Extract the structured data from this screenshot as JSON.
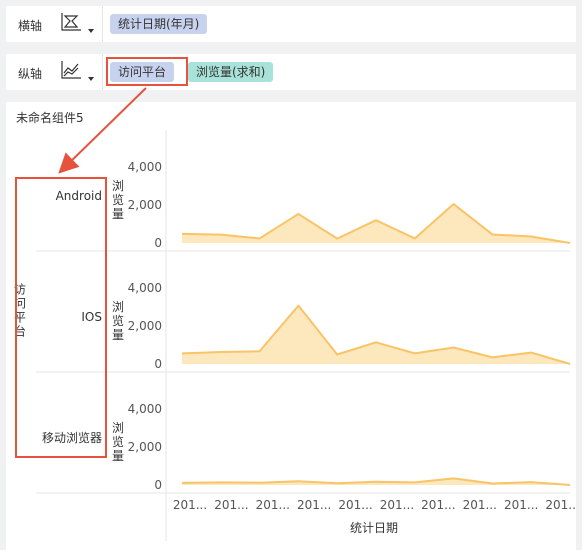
{
  "x_shelf": {
    "label": "横轴",
    "icon": "area-chart-icon",
    "fields": [
      "统计日期(年月)"
    ]
  },
  "y_shelf": {
    "label": "纵轴",
    "icon": "line-chart-icon",
    "fields": [
      "访问平台",
      "浏览量(求和)"
    ]
  },
  "widget": {
    "title": "未命名组件5"
  },
  "colors": {
    "area_fill": "#fde3b0",
    "area_line": "#f8c467",
    "dim_pill": "#c7d3ee",
    "measure_pill": "#a8e2d9",
    "highlight": "#e5533d"
  },
  "chart_data": {
    "type": "area",
    "row_dimension": "访问平台",
    "x_title": "统计日期",
    "y_title": "浏览量",
    "ylim": [
      0,
      4000
    ],
    "y_ticks": [
      "4,000",
      "2,000",
      "0"
    ],
    "y_tick_values": [
      4000,
      2000,
      0
    ],
    "x_ticks": [
      "201...",
      "201...",
      "201...",
      "201...",
      "201...",
      "201...",
      "201...",
      "201...",
      "201...",
      "201..."
    ],
    "x": [
      1,
      2,
      3,
      4,
      5,
      6,
      7,
      8,
      9,
      10,
      11
    ],
    "series": [
      {
        "name": "Android",
        "values": [
          480,
          440,
          240,
          1530,
          230,
          1200,
          240,
          2050,
          450,
          340,
          0
        ]
      },
      {
        "name": "IOS",
        "values": [
          560,
          630,
          670,
          3070,
          500,
          1140,
          560,
          870,
          350,
          600,
          0
        ]
      },
      {
        "name": "移动浏览器",
        "values": [
          110,
          140,
          120,
          200,
          90,
          170,
          140,
          350,
          80,
          150,
          0
        ]
      }
    ]
  }
}
